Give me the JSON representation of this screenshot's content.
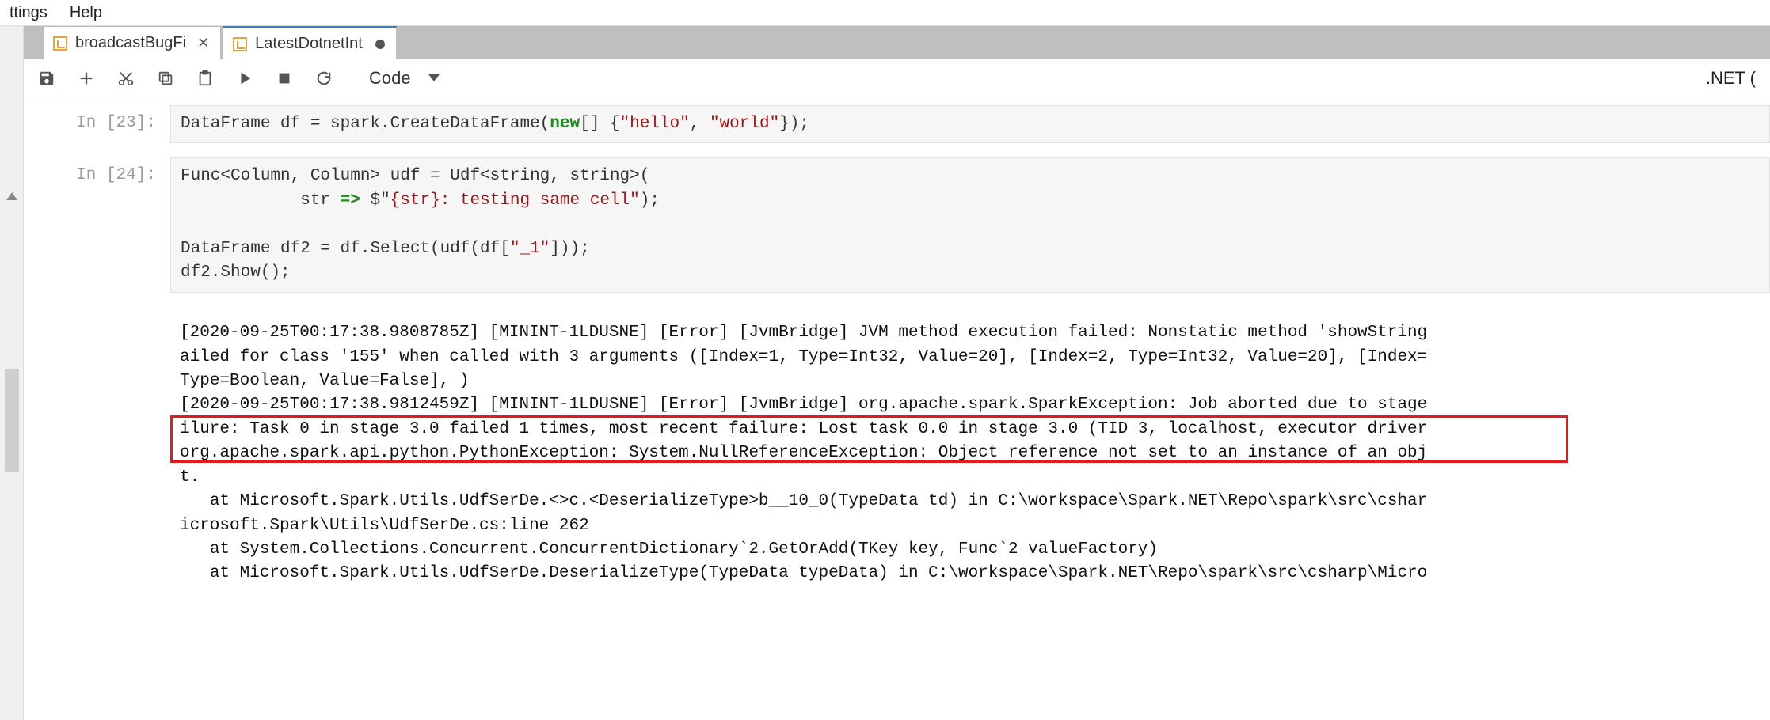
{
  "menubar": {
    "settings": "ttings",
    "help": "Help"
  },
  "tabs": [
    {
      "label": "broadcastBugFi",
      "active": false,
      "dirty": false
    },
    {
      "label": "LatestDotnetInt",
      "active": true,
      "dirty": true
    }
  ],
  "toolbar": {
    "celltype": "Code",
    "kernel": ".NET ("
  },
  "cells": [
    {
      "prompt": "In [23]:",
      "code_plain": "DataFrame df = spark.CreateDataFrame(new[] {\"hello\", \"world\"});"
    },
    {
      "prompt": "In [24]:",
      "code_line1": "Func<Column, Column> udf = Udf<string, string>(",
      "code_line2_indent": "            str ",
      "code_line2_arrow": "=>",
      "code_line2_str_open": " $\"",
      "code_line2_interp": "{str}",
      "code_line2_str_rest": ": testing same cell\"",
      "code_line2_tail": ");",
      "code_line3": "",
      "code_line4_a": "DataFrame df2 = df.Select(udf(df[",
      "code_line4_str": "\"_1\"",
      "code_line4_b": "]));",
      "code_line5": "df2.Show();",
      "output_lines": [
        "[2020-09-25T00:17:38.9808785Z] [MININT-1LDUSNE] [Error] [JvmBridge] JVM method execution failed: Nonstatic method 'showString",
        "ailed for class '155' when called with 3 arguments ([Index=1, Type=Int32, Value=20], [Index=2, Type=Int32, Value=20], [Index=",
        "Type=Boolean, Value=False], )",
        "[2020-09-25T00:17:38.9812459Z] [MININT-1LDUSNE] [Error] [JvmBridge] org.apache.spark.SparkException: Job aborted due to stage",
        "ilure: Task 0 in stage 3.0 failed 1 times, most recent failure: Lost task 0.0 in stage 3.0 (TID 3, localhost, executor driver",
        "org.apache.spark.api.python.PythonException: System.NullReferenceException: Object reference not set to an instance of an obj",
        "t.",
        "   at Microsoft.Spark.Utils.UdfSerDe.<>c.<DeserializeType>b__10_0(TypeData td) in C:\\workspace\\Spark.NET\\Repo\\spark\\src\\cshar",
        "icrosoft.Spark\\Utils\\UdfSerDe.cs:line 262",
        "   at System.Collections.Concurrent.ConcurrentDictionary`2.GetOrAdd(TKey key, Func`2 valueFactory)",
        "   at Microsoft.Spark.Utils.UdfSerDe.DeserializeType(TypeData typeData) in C:\\workspace\\Spark.NET\\Repo\\spark\\src\\csharp\\Micro"
      ]
    }
  ],
  "icons": {
    "save": "save-icon",
    "add": "add-icon",
    "cut": "cut-icon",
    "copy": "copy-icon",
    "paste": "paste-icon",
    "run": "run-icon",
    "stop": "stop-icon",
    "restart": "restart-icon",
    "chevdown": "chevron-down-icon",
    "close": "close-icon"
  }
}
